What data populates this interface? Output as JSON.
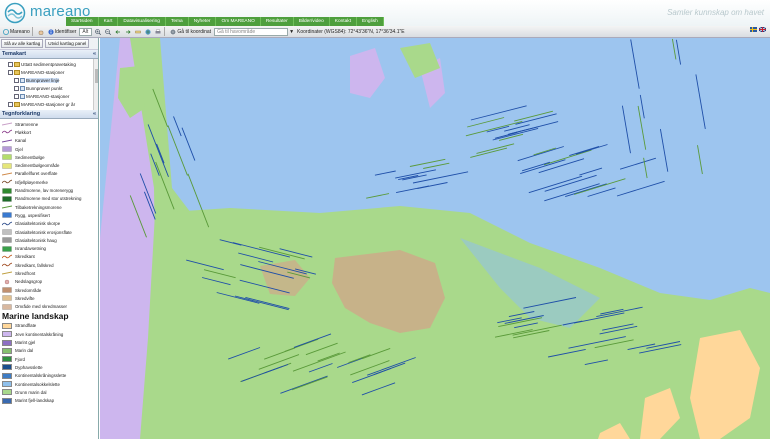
{
  "header": {
    "logo_text": "mareano",
    "tagline": "Samler kunnskap om havet",
    "nav": [
      "Startsiden",
      "Kart",
      "Datavisualisering",
      "Tema",
      "Nyheter",
      "Om MAREANO",
      "Resultater",
      "Bilder/video",
      "Kontakt",
      "English"
    ]
  },
  "toolbar": {
    "app_label": "Mareano",
    "identify_label": "Identifiser",
    "identify_value": "Alt",
    "goto_label": "Gå til koordinat",
    "area_placeholder": "Gå til havområde",
    "coord_label": "Koordinater (WGS84): 72°43'36\"N, 17°36'34.1\"E"
  },
  "left": {
    "buttons": [
      "Slå av alle kartlag",
      "Utvid kartlag panel"
    ],
    "tree_title": "Temakart",
    "tree_items": [
      {
        "label": "Uttatt sedimentprøvetaking",
        "indent": 1,
        "folder": true
      },
      {
        "label": "MAREANO-stasjoner",
        "indent": 1,
        "folder": true
      },
      {
        "label": "Bunnprøver linje",
        "indent": 2,
        "folder": false,
        "selected": true
      },
      {
        "label": "Bunnprøver punkt",
        "indent": 2,
        "folder": false
      },
      {
        "label": "MAREANO-stasjoner",
        "indent": 2,
        "folder": false
      },
      {
        "label": "MAREANO-stasjoner gr år",
        "indent": 1,
        "folder": true
      }
    ],
    "legend_title": "Tegnforklaring",
    "legend_items": [
      {
        "label": "Strømrenne",
        "color": "#c9a0c8",
        "kind": "line"
      },
      {
        "label": "Pløkkort",
        "color": "#8a3c8a",
        "kind": "squiggle"
      },
      {
        "label": "Kanal",
        "color": "#7a4aa0",
        "kind": "line"
      },
      {
        "label": "Gjel",
        "color": "#b59ad8",
        "kind": "fill"
      },
      {
        "label": "Sedimentbølge",
        "color": "#b4dd6c",
        "kind": "fill"
      },
      {
        "label": "Sedimentbølgeområde",
        "color": "#e5e67a",
        "kind": "fill"
      },
      {
        "label": "Parallellfuret overflate",
        "color": "#d08a4a",
        "kind": "line"
      },
      {
        "label": "Isfjellpløyemerke",
        "color": "#7a4a2a",
        "kind": "squiggle"
      },
      {
        "label": "Randmorene, lav morenerygg",
        "color": "#2f8a2f",
        "kind": "fill"
      },
      {
        "label": "Randmorene med stor utstrekning",
        "color": "#1f6e2a",
        "kind": "fill"
      },
      {
        "label": "Tilbaketrekningsmorene",
        "color": "#5a9a3a",
        "kind": "line"
      },
      {
        "label": "Rygg, uspesifisert",
        "color": "#3a7ad0",
        "kind": "fill"
      },
      {
        "label": "Glasialtektonisk skorpe",
        "color": "#2a4a8a",
        "kind": "squiggle"
      },
      {
        "label": "Glasialtektonisk erosjonsflate",
        "color": "#c0c0c0",
        "kind": "fill"
      },
      {
        "label": "Glasialtektonisk haug",
        "color": "#9a9a9a",
        "kind": "fill"
      },
      {
        "label": "Israndavsetning",
        "color": "#3aa04a",
        "kind": "fill"
      },
      {
        "label": "Skredkant",
        "color": "#c05a20",
        "kind": "squiggle"
      },
      {
        "label": "Skredkant, fallskred",
        "color": "#a04a20",
        "kind": "squiggle"
      },
      {
        "label": "Skredfront",
        "color": "#c0a040",
        "kind": "line"
      },
      {
        "label": "Nedslagsgrop",
        "color": "#e0b0b0",
        "kind": "dot"
      },
      {
        "label": "Skredområde",
        "color": "#c09070",
        "kind": "fill"
      },
      {
        "label": "Skredvifte",
        "color": "#e0c090",
        "kind": "fill"
      },
      {
        "label": "Område med skredmasser",
        "color": "#d8b8a0",
        "kind": "fill"
      }
    ],
    "landscape_title": "Marine landskap",
    "landscape_items": [
      {
        "label": "Strandflate",
        "color": "#ffd79a"
      },
      {
        "label": "Jevn kontinentalskråning",
        "color": "#cdb6ee"
      },
      {
        "label": "Marint gjel",
        "color": "#8e6fc4"
      },
      {
        "label": "Marin dal",
        "color": "#86c070"
      },
      {
        "label": "Fjord",
        "color": "#2f8f3f"
      },
      {
        "label": "Dyphavsslette",
        "color": "#1b4e8c"
      },
      {
        "label": "Kontinentalskråningsslette",
        "color": "#3e7cc4"
      },
      {
        "label": "Kontinentalsokkelslette",
        "color": "#8fc0ec"
      },
      {
        "label": "Grunn marin dal",
        "color": "#a9d98b"
      },
      {
        "label": "Marint fjell-landskap",
        "color": "#3a6ab0"
      }
    ]
  },
  "colors": {
    "sea": "#9dc5ef",
    "shelf": "#a9d98b",
    "bank": "#c7b289",
    "slope": "#cdb6ee",
    "strand": "#ffd79a",
    "ridge_lines": "#1f4fa8",
    "glacial_lines": "#5a9a3a",
    "brand": "#3a9fbf",
    "nav": "#4e9f3d"
  }
}
